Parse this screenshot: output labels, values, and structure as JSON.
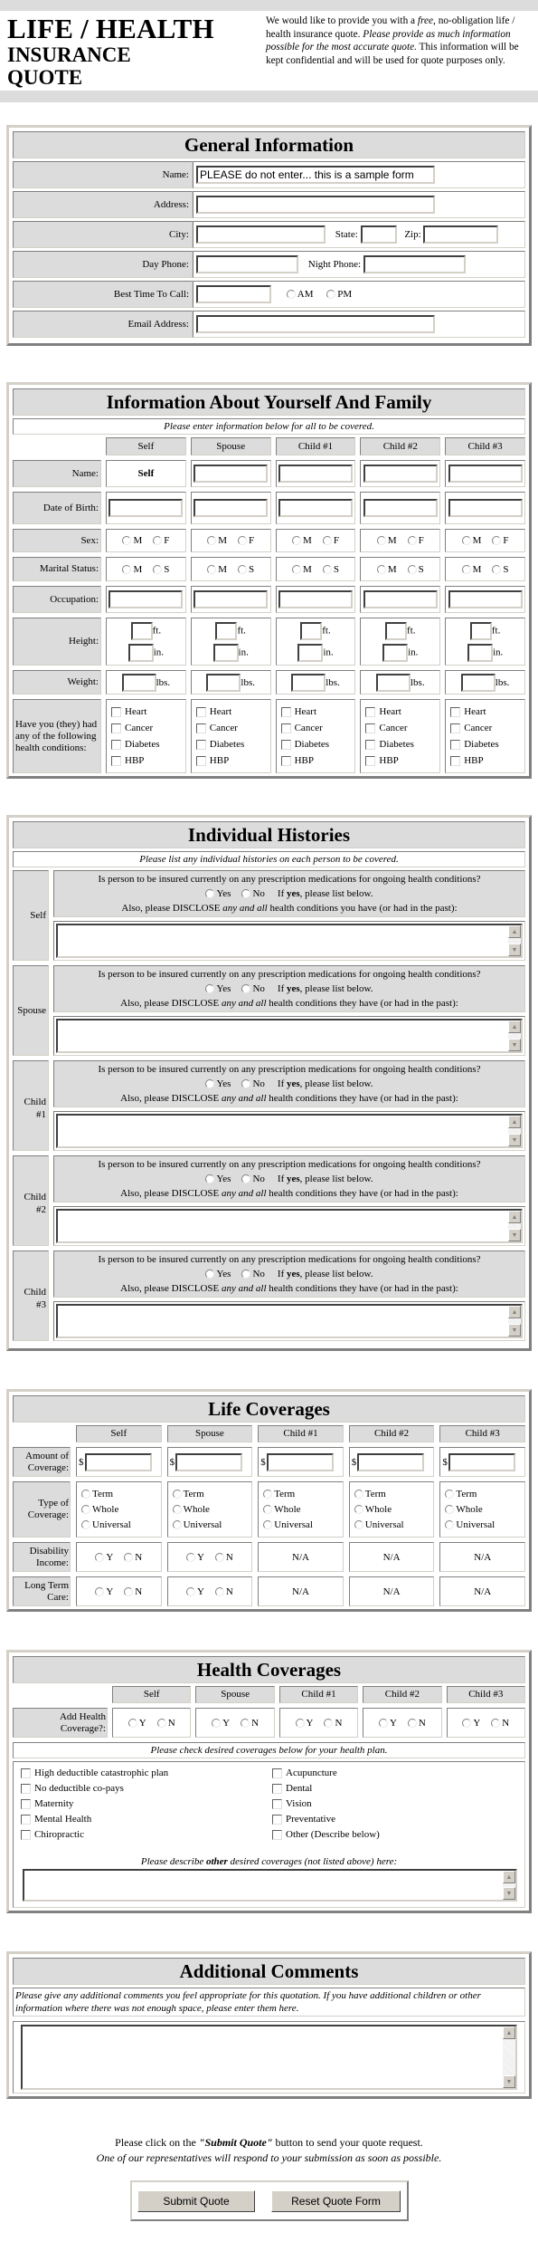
{
  "header": {
    "title_line1": "LIFE / HEALTH",
    "title_line2": "INSURANCE",
    "title_line3": "QUOTE",
    "intro_part1": "We would like to provide you with a ",
    "intro_free": "free",
    "intro_part2": ", no-obligation life / health insurance quote. ",
    "intro_italic": "Please provide as much information possible for the most accurate quote.",
    "intro_part3": " This information will be kept confidential and will be used for quote purposes only."
  },
  "general": {
    "title": "General Information",
    "name_label": "Name:",
    "name_value": "PLEASE do not enter... this is a sample form",
    "address_label": "Address:",
    "city_label": "City:",
    "state_label": "State:",
    "zip_label": "Zip:",
    "day_phone_label": "Day Phone:",
    "night_phone_label": "Night Phone:",
    "best_time_label": "Best Time To Call:",
    "am_label": "AM",
    "pm_label": "PM",
    "email_label": "Email Address:"
  },
  "family": {
    "title": "Information About Yourself And Family",
    "note": "Please enter information below for all to be covered.",
    "columns": [
      "Self",
      "Spouse",
      "Child #1",
      "Child #2",
      "Child #3"
    ],
    "self_name": "Self",
    "rows": {
      "name": "Name:",
      "dob": "Date of Birth:",
      "sex": "Sex:",
      "marital": "Marital Status:",
      "occupation": "Occupation:",
      "height": "Height:",
      "weight": "Weight:",
      "conditions": "Have you (they) had any of the following health conditions:"
    },
    "sex_options": [
      "M",
      "F"
    ],
    "marital_options": [
      "M",
      "S"
    ],
    "ft_label": "ft.",
    "in_label": "in.",
    "lbs_label": "lbs.",
    "condition_options": [
      "Heart",
      "Cancer",
      "Diabetes",
      "HBP"
    ]
  },
  "histories": {
    "title": "Individual Histories",
    "note": "Please list any individual histories on each person to be covered.",
    "question": "Is person to be insured currently on any prescription medications for ongoing health conditions?",
    "yes_label": "Yes",
    "no_label": "No",
    "if_prefix": "If ",
    "if_bold": "yes",
    "if_suffix": ", please list below.",
    "disclose_prefix": "Also, please DISCLOSE ",
    "disclose_italic": "any and all",
    "disclose_suffix_self": " health conditions you have (or had in the past):",
    "disclose_suffix_other": " health conditions they have (or had in the past):",
    "people": [
      "Self",
      "Spouse",
      "Child #1",
      "Child #2",
      "Child #3"
    ]
  },
  "life": {
    "title": "Life Coverages",
    "columns": [
      "Self",
      "Spouse",
      "Child #1",
      "Child #2",
      "Child #3"
    ],
    "amount_label": "Amount of Coverage:",
    "currency": "$",
    "type_label": "Type of Coverage:",
    "type_options": [
      "Term",
      "Whole",
      "Universal"
    ],
    "disability_label": "Disability Income:",
    "ltc_label": "Long Term Care:",
    "yn_options": [
      "Y",
      "N"
    ],
    "na": "N/A"
  },
  "health": {
    "title": "Health Coverages",
    "columns": [
      "Self",
      "Spouse",
      "Child #1",
      "Child #2",
      "Child #3"
    ],
    "add_label": "Add Health Coverage?:",
    "yn_options": [
      "Y",
      "N"
    ],
    "note": "Please check desired coverages below for your health plan.",
    "left_options": [
      "High deductible catastrophic plan",
      "No deductible co-pays",
      "Maternity",
      "Mental Health",
      "Chiropractic"
    ],
    "right_options": [
      "Acupuncture",
      "Dental",
      "Vision",
      "Preventative",
      "Other (Describe below)"
    ],
    "other_prefix": "Please describe ",
    "other_bold": "other",
    "other_suffix": " desired coverages (not listed above) here:"
  },
  "comments": {
    "title": "Additional Comments",
    "note": "Please give any additional comments you feel appropriate for this quotation. If you have additional children or other information where there was not enough space, please enter them here."
  },
  "footer": {
    "line1_prefix": "Please click on the ",
    "line1_bold": "\"Submit Quote\"",
    "line1_suffix": " button to send your quote request.",
    "line2": "One of our representatives will respond to your submission as soon as possible.",
    "submit_label": "Submit Quote",
    "reset_label": "Reset Quote Form"
  }
}
